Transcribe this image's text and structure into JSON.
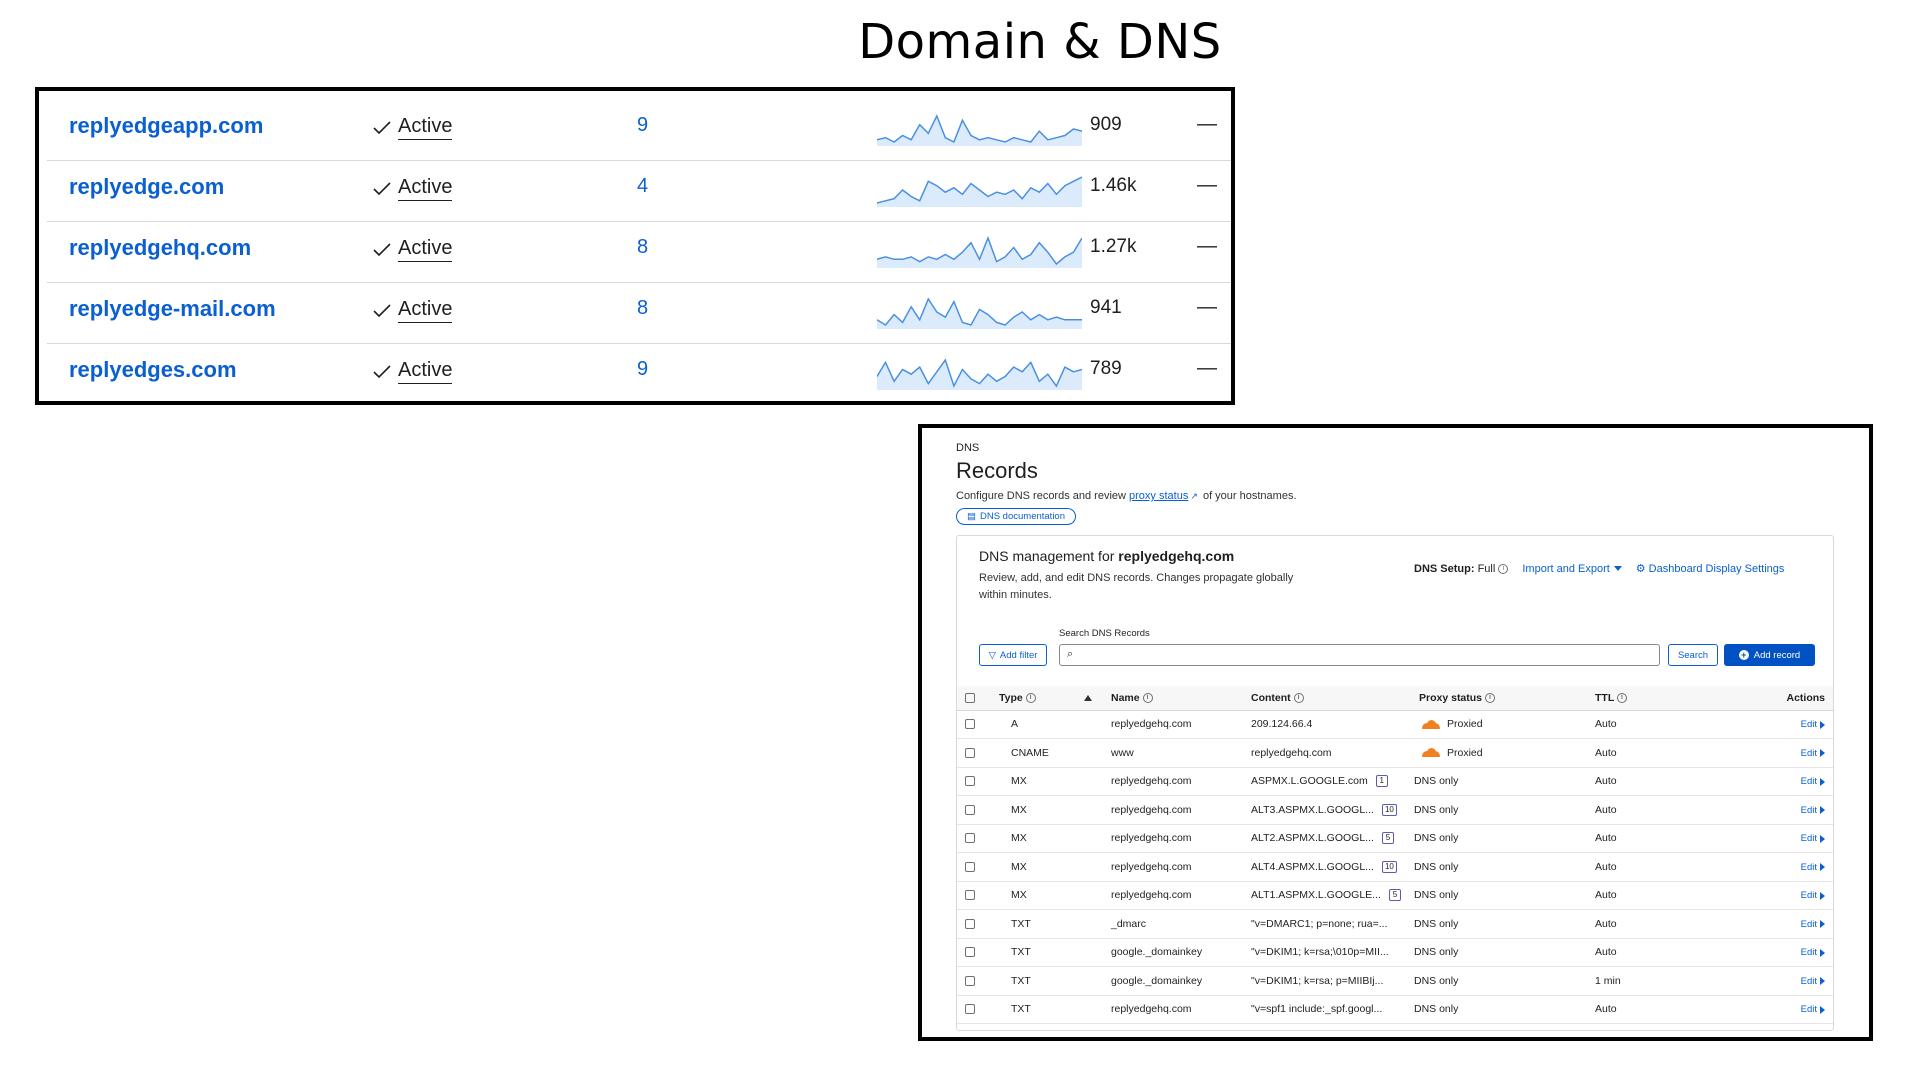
{
  "page_title": "Domain & DNS",
  "domains": [
    {
      "name": "replyedgeapp.com",
      "status": "Active",
      "records": "9",
      "requests": "909",
      "dash": "—"
    },
    {
      "name": "replyedge.com",
      "status": "Active",
      "records": "4",
      "requests": "1.46k",
      "dash": "—"
    },
    {
      "name": "replyedgehq.com",
      "status": "Active",
      "records": "8",
      "requests": "1.27k",
      "dash": "—"
    },
    {
      "name": "replyedge-mail.com",
      "status": "Active",
      "records": "8",
      "requests": "941",
      "dash": "—"
    },
    {
      "name": "replyedges.com",
      "status": "Active",
      "records": "9",
      "requests": "789",
      "dash": "—"
    }
  ],
  "dns": {
    "kicker": "DNS",
    "heading": "Records",
    "desc_before": "Configure DNS records and review ",
    "desc_link": "proxy status",
    "desc_after": " of your hostnames.",
    "doc_button": "DNS documentation",
    "mgmt_title_prefix": "DNS management for ",
    "mgmt_domain": "replyedgehq.com",
    "mgmt_desc": "Review, add, and edit DNS records. Changes propagate globally within minutes.",
    "setup_label": "DNS Setup:",
    "setup_value": "Full",
    "import_export": "Import and Export",
    "display_settings": "Dashboard Display Settings",
    "search_label": "Search DNS Records",
    "search_placeholder": "",
    "add_filter": "Add filter",
    "search_button": "Search",
    "add_record": "Add record",
    "columns": {
      "type": "Type",
      "name": "Name",
      "content": "Content",
      "proxy": "Proxy status",
      "ttl": "TTL",
      "actions": "Actions"
    },
    "edit_label": "Edit",
    "records": [
      {
        "type": "A",
        "name": "replyedgehq.com",
        "content": "209.124.66.4",
        "priority": "",
        "proxy": "Proxied",
        "proxied": true,
        "ttl": "Auto"
      },
      {
        "type": "CNAME",
        "name": "www",
        "content": "replyedgehq.com",
        "priority": "",
        "proxy": "Proxied",
        "proxied": true,
        "ttl": "Auto"
      },
      {
        "type": "MX",
        "name": "replyedgehq.com",
        "content": "ASPMX.L.GOOGLE.com",
        "priority": "1",
        "proxy": "DNS only",
        "proxied": false,
        "ttl": "Auto"
      },
      {
        "type": "MX",
        "name": "replyedgehq.com",
        "content": "ALT3.ASPMX.L.GOOGL...",
        "priority": "10",
        "proxy": "DNS only",
        "proxied": false,
        "ttl": "Auto"
      },
      {
        "type": "MX",
        "name": "replyedgehq.com",
        "content": "ALT2.ASPMX.L.GOOGL...",
        "priority": "5",
        "proxy": "DNS only",
        "proxied": false,
        "ttl": "Auto"
      },
      {
        "type": "MX",
        "name": "replyedgehq.com",
        "content": "ALT4.ASPMX.L.GOOGL...",
        "priority": "10",
        "proxy": "DNS only",
        "proxied": false,
        "ttl": "Auto"
      },
      {
        "type": "MX",
        "name": "replyedgehq.com",
        "content": "ALT1.ASPMX.L.GOOGLE...",
        "priority": "5",
        "proxy": "DNS only",
        "proxied": false,
        "ttl": "Auto"
      },
      {
        "type": "TXT",
        "name": "_dmarc",
        "content": "\"v=DMARC1; p=none; rua=...",
        "priority": "",
        "proxy": "DNS only",
        "proxied": false,
        "ttl": "Auto"
      },
      {
        "type": "TXT",
        "name": "google._domainkey",
        "content": "\"v=DKIM1; k=rsa;\\010p=MII...",
        "priority": "",
        "proxy": "DNS only",
        "proxied": false,
        "ttl": "Auto"
      },
      {
        "type": "TXT",
        "name": "google._domainkey",
        "content": "\"v=DKIM1; k=rsa; p=MIIBIj...",
        "priority": "",
        "proxy": "DNS only",
        "proxied": false,
        "ttl": "1 min"
      },
      {
        "type": "TXT",
        "name": "replyedgehq.com",
        "content": "\"v=spf1 include:_spf.googl...",
        "priority": "",
        "proxy": "DNS only",
        "proxied": false,
        "ttl": "Auto"
      }
    ]
  },
  "colors": {
    "link": "#0a5fd1",
    "proxy_orange": "#f38020",
    "spark": "#4a90e2",
    "spark_fill": "#dcebfb"
  },
  "sparklines": [
    [
      5,
      6,
      4,
      7,
      5,
      12,
      8,
      16,
      6,
      4,
      14,
      7,
      5,
      6,
      5,
      4,
      6,
      5,
      4,
      9,
      5,
      6,
      7,
      10,
      9
    ],
    [
      4,
      5,
      6,
      10,
      7,
      5,
      14,
      12,
      9,
      11,
      8,
      13,
      10,
      7,
      9,
      8,
      10,
      6,
      11,
      9,
      13,
      8,
      12,
      14,
      16
    ],
    [
      5,
      6,
      5,
      5,
      6,
      4,
      6,
      5,
      7,
      5,
      8,
      12,
      5,
      14,
      4,
      6,
      10,
      5,
      7,
      12,
      8,
      3,
      6,
      8,
      14
    ],
    [
      6,
      4,
      8,
      5,
      11,
      6,
      14,
      9,
      7,
      13,
      5,
      4,
      10,
      8,
      5,
      4,
      7,
      9,
      6,
      8,
      6,
      7,
      6,
      6,
      6
    ],
    [
      8,
      14,
      6,
      11,
      9,
      12,
      5,
      10,
      15,
      4,
      11,
      7,
      5,
      9,
      6,
      8,
      12,
      10,
      14,
      6,
      9,
      4,
      12,
      10,
      11
    ]
  ]
}
